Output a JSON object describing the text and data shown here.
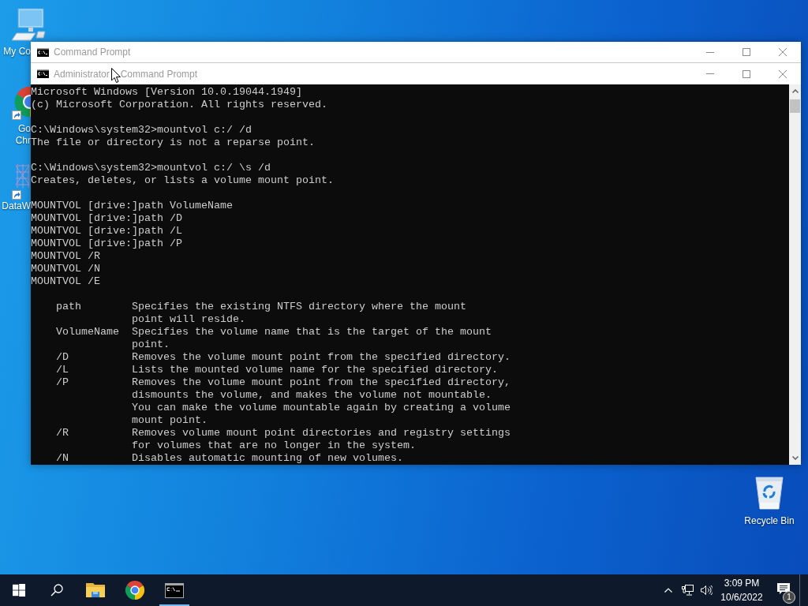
{
  "desktop_icons": [
    {
      "kind": "computer",
      "lines": [
        "My Co"
      ]
    },
    {
      "kind": "browser_shortcut",
      "lines": [
        "Go",
        "Chr"
      ]
    },
    {
      "kind": "app_shortcut",
      "lines": [
        "DataW"
      ]
    }
  ],
  "windows": [
    {
      "title": [
        "Command Prompt"
      ]
    },
    {
      "title": [
        "Administrator",
        "Command Prompt"
      ]
    }
  ],
  "console": {
    "blocks": [
      [
        "Microsoft Windows [Version 10.0.19044.1949]",
        "(c) Microsoft Corporation. All rights reserved."
      ],
      [
        "C:\\Windows\\system32>mountvol c:/ /d",
        "The file or directory is not a reparse point."
      ],
      [
        "C:\\Windows\\system32>mountvol c:/ \\s /d",
        "Creates, deletes, or lists a volume mount point."
      ],
      [
        "MOUNTVOL [drive:]path VolumeName",
        "MOUNTVOL [drive:]path /D",
        "MOUNTVOL [drive:]path /L",
        "MOUNTVOL [drive:]path /P",
        "MOUNTVOL /R",
        "MOUNTVOL /N",
        "MOUNTVOL /E"
      ]
    ],
    "options": [
      {
        "name": "path",
        "lines": [
          "Specifies the existing NTFS directory where the mount",
          "point will reside."
        ]
      },
      {
        "name": "VolumeName",
        "lines": [
          "Specifies the volume name that is the target of the mount",
          "point."
        ]
      },
      {
        "name": "/D",
        "lines": [
          "Removes the volume mount point from the specified directory."
        ]
      },
      {
        "name": "/L",
        "lines": [
          "Lists the mounted volume name for the specified directory."
        ]
      },
      {
        "name": "/P",
        "lines": [
          "Removes the volume mount point from the specified directory,",
          "dismounts the volume, and makes the volume not mountable.",
          "You can make the volume mountable again by creating a volume",
          "mount point."
        ]
      },
      {
        "name": "/R",
        "lines": [
          "Removes volume mount point directories and registry settings",
          "for volumes that are no longer in the system."
        ]
      },
      {
        "name": "/N",
        "lines": [
          "Disables automatic mounting of new volumes."
        ]
      }
    ]
  },
  "recycle_bin": {
    "label": "Recycle Bin"
  },
  "taskbar": {
    "apps": [
      {
        "kind": "explorer",
        "running": false
      },
      {
        "kind": "browser",
        "running": false
      },
      {
        "kind": "terminal",
        "running": true
      }
    ],
    "clock": {
      "time": "3:09 PM",
      "date": "10/6/2022"
    },
    "notifications": {
      "count": "1"
    }
  }
}
